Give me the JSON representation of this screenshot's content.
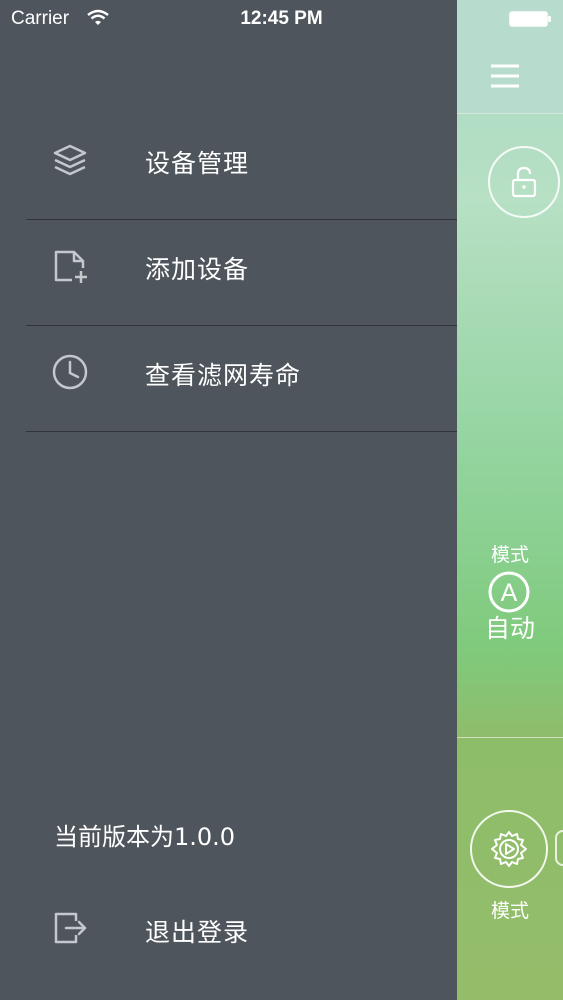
{
  "status_bar": {
    "carrier": "Carrier",
    "time": "12:45 PM"
  },
  "drawer": {
    "menu": [
      {
        "label": "设备管理",
        "icon": "layers-icon"
      },
      {
        "label": "添加设备",
        "icon": "add-file-icon"
      },
      {
        "label": "查看滤网寿命",
        "icon": "clock-icon"
      }
    ],
    "version_text": "当前版本为1.0.0",
    "logout_label": "退出登录"
  },
  "main": {
    "mode_title": "模式",
    "auto_symbol": "A",
    "auto_label": "自动",
    "mode_bottom_label": "模式"
  },
  "colors": {
    "drawer_bg": "#4e555c",
    "text": "#ffffff",
    "icon": "#c3c8cd",
    "accent_green": "#8ebd69"
  }
}
